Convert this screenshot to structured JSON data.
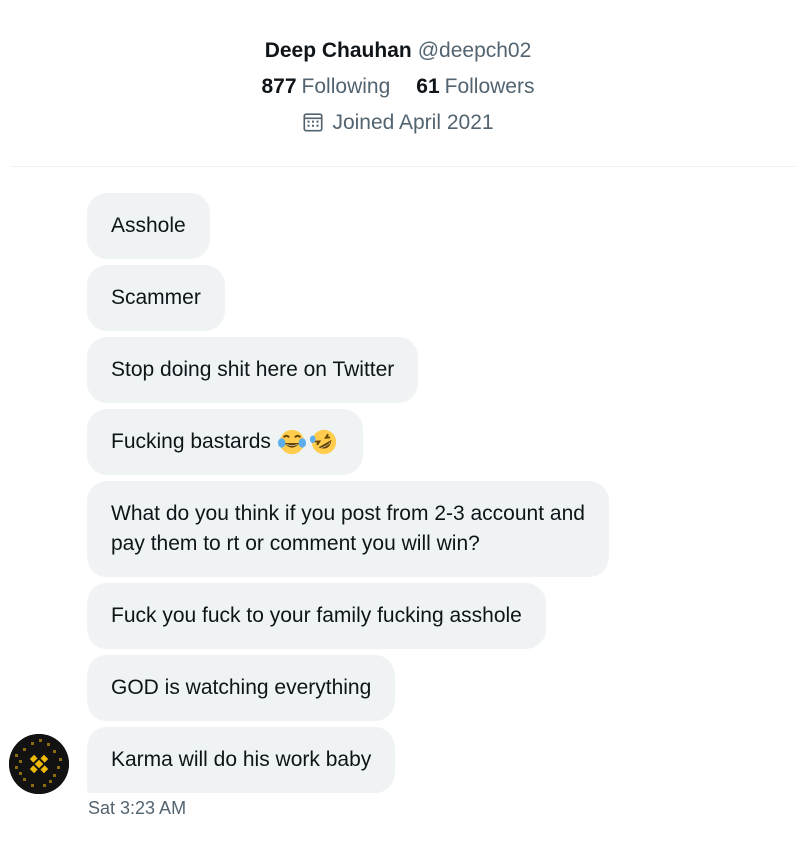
{
  "profile": {
    "display_name": "Deep Chauhan",
    "handle": "@deepch02",
    "following_count": "877",
    "following_label": "Following",
    "followers_count": "61",
    "followers_label": "Followers",
    "joined": "Joined April 2021"
  },
  "messages": [
    {
      "text": "Asshole"
    },
    {
      "text": "Scammer"
    },
    {
      "text": "Stop doing shit here on Twitter"
    },
    {
      "text": "Fucking bastards",
      "emojis": [
        "face-with-tears-of-joy",
        "rolling-on-the-floor-laughing"
      ]
    },
    {
      "text_line1": "What do you think if you post from 2-3 account and",
      "text_line2": "pay them to rt or comment you will win?"
    },
    {
      "text": "Fuck you fuck to your family fucking asshole"
    },
    {
      "text": "GOD is watching everything"
    },
    {
      "text": "Karma will do his work baby"
    }
  ],
  "timestamp": "Sat 3:23 AM",
  "icons": {
    "joined": "calendar-icon",
    "avatar": "binance-logo-avatar"
  },
  "colors": {
    "bubble_bg": "#eff3f4",
    "secondary_text": "#536471",
    "primary_text": "#0f1419",
    "avatar_accent": "#f0b90b"
  }
}
